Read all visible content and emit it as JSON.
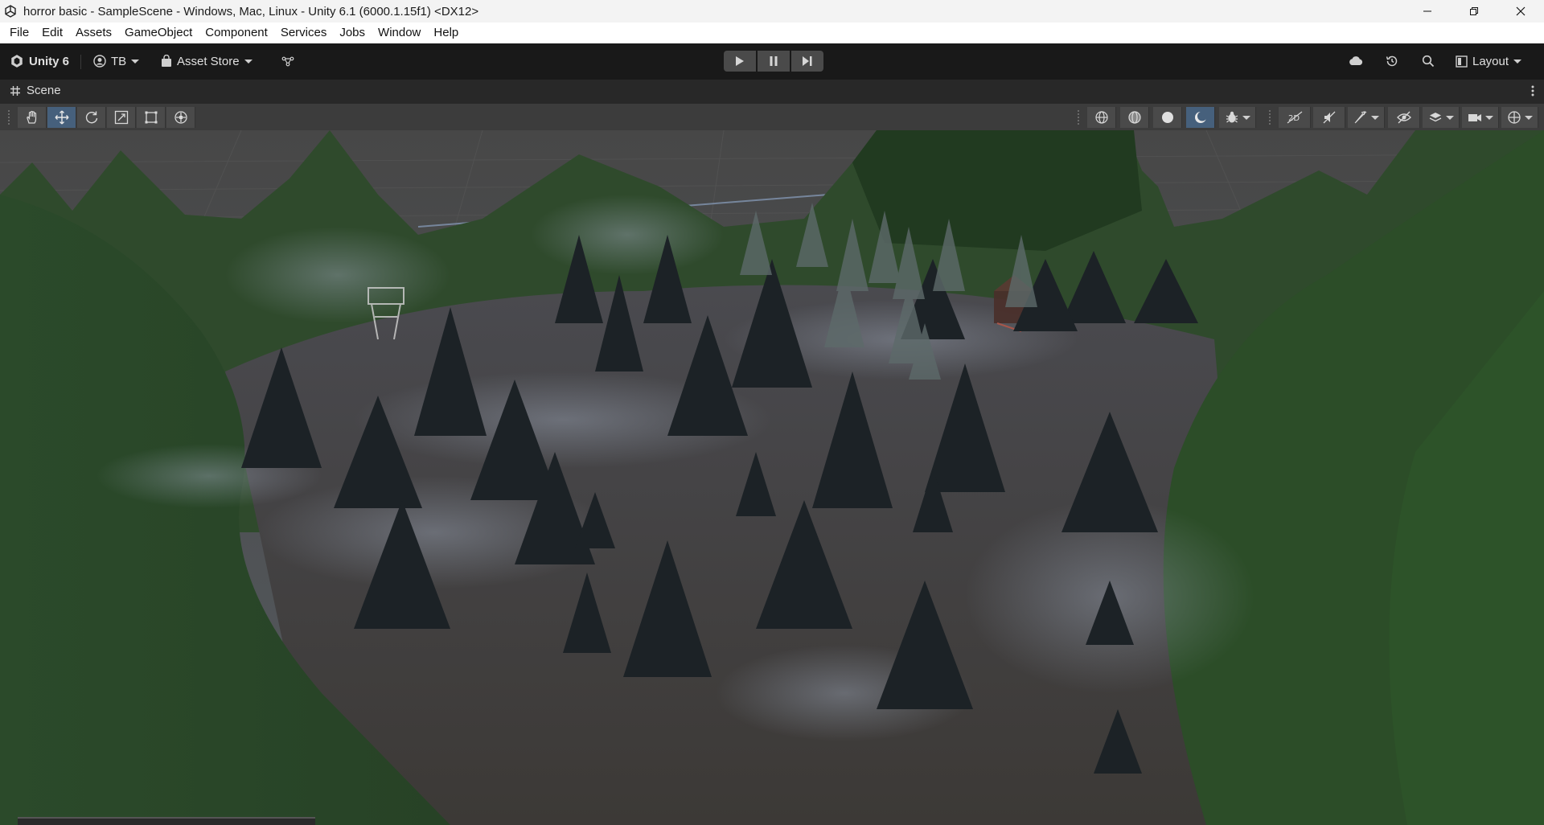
{
  "window": {
    "title": "horror basic - SampleScene - Windows, Mac, Linux - Unity 6.1 (6000.1.15f1) <DX12>"
  },
  "menu": [
    "File",
    "Edit",
    "Assets",
    "GameObject",
    "Component",
    "Services",
    "Jobs",
    "Window",
    "Help"
  ],
  "toolbar": {
    "unity_label": "Unity 6",
    "account_label": "TB",
    "asset_store_label": "Asset Store",
    "layout_label": "Layout"
  },
  "scene_tab": {
    "label": "Scene"
  },
  "icons": {
    "unity_logo": "unity-logo-icon",
    "account": "account-icon",
    "store": "store-bag-icon",
    "version_control": "branch-icon",
    "play": "play-icon",
    "pause": "pause-icon",
    "step": "step-icon",
    "cloud": "cloud-icon",
    "history": "history-icon",
    "search": "search-icon",
    "layout": "layout-icon"
  },
  "colors": {
    "toolbar_bg": "#191919",
    "active_tool": "#46607c",
    "sky": "#4a4a4a",
    "terrain_green": "#2a4a25",
    "ground": "#3e3c3b"
  }
}
